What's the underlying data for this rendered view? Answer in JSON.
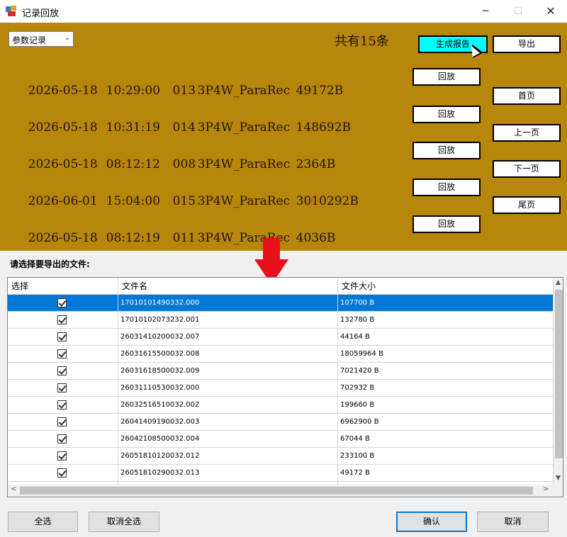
{
  "window": {
    "title": "记录回放",
    "minimize_glyph": "─",
    "maximize_glyph": "☐",
    "close_glyph": "✕"
  },
  "panel": {
    "background_color": "#b8860b",
    "filter": {
      "selected": "参数记录",
      "arrow": "⌄"
    },
    "count_text": "共有15条",
    "records": [
      {
        "date": "2026-05-18",
        "time": "10:29:00",
        "num": "013",
        "name": "3P4W_ParaRec",
        "size": "49172B",
        "play_label": "回放"
      },
      {
        "date": "2026-05-18",
        "time": "10:31:19",
        "num": "014",
        "name": "3P4W_ParaRec",
        "size": "148692B",
        "play_label": "回放"
      },
      {
        "date": "2026-05-18",
        "time": "08:12:12",
        "num": "008",
        "name": "3P4W_ParaRec",
        "size": "2364B",
        "play_label": "回放"
      },
      {
        "date": "2026-06-01",
        "time": "15:04:00",
        "num": "015",
        "name": "3P4W_ParaRec",
        "size": "3010292B",
        "play_label": "回放"
      },
      {
        "date": "2026-05-18",
        "time": "08:12:19",
        "num": "011",
        "name": "3P4W_ParaRec",
        "size": "4036B",
        "play_label": "回放"
      }
    ],
    "buttons": {
      "report": "生成报告",
      "export": "导出",
      "first": "首页",
      "prev": "上一页",
      "next": "下一页",
      "last": "尾页"
    }
  },
  "export": {
    "label": "请选择要导出的文件:",
    "columns": [
      "选择",
      "文件名",
      "文件大小"
    ],
    "rows": [
      {
        "checked": true,
        "file": "17010101490332.000",
        "size": "107700 B",
        "selected": true
      },
      {
        "checked": true,
        "file": "17010102073232.001",
        "size": "132780 B"
      },
      {
        "checked": true,
        "file": "26031410200032.007",
        "size": "44164 B"
      },
      {
        "checked": true,
        "file": "26031615500032.008",
        "size": "18059964 B"
      },
      {
        "checked": true,
        "file": "26031618500032.009",
        "size": "7021420 B"
      },
      {
        "checked": true,
        "file": "26031110530032.000",
        "size": "702932 B"
      },
      {
        "checked": true,
        "file": "26032516510032.002",
        "size": "199660 B"
      },
      {
        "checked": true,
        "file": "26041409190032.003",
        "size": "6962900 B"
      },
      {
        "checked": true,
        "file": "26042108500032.004",
        "size": "67044 B"
      },
      {
        "checked": true,
        "file": "26051810120032.012",
        "size": "233100 B"
      },
      {
        "checked": true,
        "file": "26051810290032.013",
        "size": "49172 B"
      },
      {
        "checked": true,
        "file": "",
        "size": ""
      }
    ],
    "scroll": {
      "up": "▲",
      "down": "▼",
      "left": "<",
      "right": ">"
    },
    "buttons": {
      "select_all": "全选",
      "deselect_all": "取消全选",
      "confirm": "确认",
      "cancel": "取消"
    }
  },
  "colors": {
    "report_button": "#00ffff",
    "selected_row": "#0078d7",
    "arrow": "#e8101a"
  }
}
